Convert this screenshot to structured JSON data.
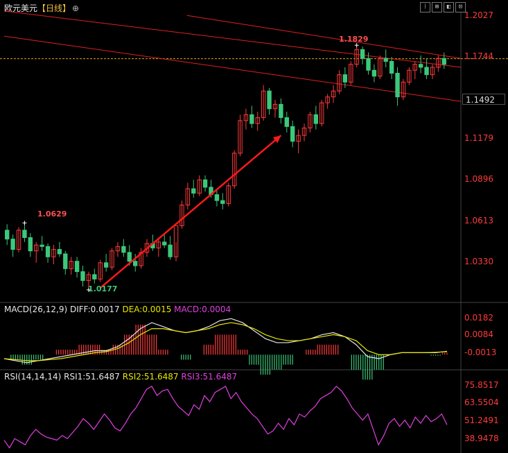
{
  "header": {
    "instrument": "欧元美元",
    "period": "【日线】",
    "settings_glyph": "⊕",
    "toolbar": [
      "⁞",
      "⊞",
      "◧",
      "⊡"
    ]
  },
  "main_price_axis": {
    "ticks": [
      "1.2027",
      "1.1744",
      "1.1492",
      "1.1179",
      "1.0896",
      "1.0613",
      "1.0330"
    ],
    "current_price": "1.1492"
  },
  "annotations": {
    "high_label": "1.1829",
    "early_high_label": "1.0629",
    "low_label": "1.0177"
  },
  "macd_panel": {
    "label_name": "MACD(26,12,9)",
    "diff": "DIFF:0.0017",
    "dea": "DEA:0.0015",
    "macd": "MACD:0.0004",
    "ticks": [
      "0.0182",
      "0.0084",
      "-0.0013"
    ]
  },
  "rsi_panel": {
    "label_name": "RSI(14,14,14)",
    "rsi1": "RSI1:51.6487",
    "rsi2": "RSI2:51.6487",
    "rsi3": "RSI3:51.6487",
    "ticks": [
      "75.8517",
      "63.5504",
      "51.2491",
      "38.9478"
    ]
  },
  "colors": {
    "up": "#ff3b3b",
    "down": "#3cc87a",
    "channel": "#e02020",
    "arrow": "#ff1a1a",
    "diff_line": "#e8e8e8",
    "dea_line": "#e8e800",
    "rsi_line": "#e040e0"
  },
  "chart_data": [
    {
      "type": "candlestick",
      "title": "欧元美元【日线】",
      "ylim": [
        1.012,
        1.205
      ],
      "price_ticks": [
        1.2027,
        1.1744,
        1.1492,
        1.1179,
        1.0896,
        1.0613,
        1.033
      ],
      "current_price": 1.1492,
      "reference_line": 1.1738,
      "annotations": [
        {
          "label": "1.1829",
          "value": 1.1829,
          "kind": "high"
        },
        {
          "label": "1.0629",
          "value": 1.0629,
          "kind": "high"
        },
        {
          "label": "1.0177",
          "value": 1.0177,
          "kind": "low"
        }
      ],
      "candles_ohlc": [
        [
          1.058,
          1.062,
          1.048,
          1.052
        ],
        [
          1.052,
          1.055,
          1.04,
          1.045
        ],
        [
          1.045,
          1.06,
          1.043,
          1.058
        ],
        [
          1.058,
          1.063,
          1.05,
          1.053
        ],
        [
          1.053,
          1.056,
          1.04,
          1.044
        ],
        [
          1.044,
          1.05,
          1.036,
          1.048
        ],
        [
          1.048,
          1.054,
          1.044,
          1.047
        ],
        [
          1.047,
          1.049,
          1.036,
          1.04
        ],
        [
          1.04,
          1.048,
          1.035,
          1.045
        ],
        [
          1.045,
          1.05,
          1.04,
          1.042
        ],
        [
          1.042,
          1.044,
          1.028,
          1.032
        ],
        [
          1.032,
          1.04,
          1.028,
          1.037
        ],
        [
          1.037,
          1.04,
          1.026,
          1.03
        ],
        [
          1.03,
          1.034,
          1.02,
          1.024
        ],
        [
          1.024,
          1.03,
          1.018,
          1.028
        ],
        [
          1.028,
          1.032,
          1.022,
          1.025
        ],
        [
          1.025,
          1.038,
          1.023,
          1.036
        ],
        [
          1.036,
          1.042,
          1.03,
          1.033
        ],
        [
          1.033,
          1.046,
          1.031,
          1.044
        ],
        [
          1.044,
          1.05,
          1.04,
          1.047
        ],
        [
          1.047,
          1.052,
          1.04,
          1.043
        ],
        [
          1.043,
          1.048,
          1.034,
          1.037
        ],
        [
          1.037,
          1.042,
          1.03,
          1.034
        ],
        [
          1.034,
          1.046,
          1.032,
          1.043
        ],
        [
          1.043,
          1.052,
          1.04,
          1.049
        ],
        [
          1.049,
          1.055,
          1.044,
          1.046
        ],
        [
          1.046,
          1.052,
          1.04,
          1.05
        ],
        [
          1.05,
          1.056,
          1.046,
          1.048
        ],
        [
          1.048,
          1.054,
          1.038,
          1.04
        ],
        [
          1.04,
          1.05,
          1.037,
          1.061
        ],
        [
          1.061,
          1.078,
          1.059,
          1.075
        ],
        [
          1.075,
          1.09,
          1.072,
          1.086
        ],
        [
          1.086,
          1.092,
          1.08,
          1.083
        ],
        [
          1.083,
          1.095,
          1.081,
          1.092
        ],
        [
          1.092,
          1.095,
          1.084,
          1.087
        ],
        [
          1.087,
          1.092,
          1.08,
          1.082
        ],
        [
          1.082,
          1.086,
          1.074,
          1.078
        ],
        [
          1.078,
          1.083,
          1.072,
          1.076
        ],
        [
          1.076,
          1.09,
          1.074,
          1.088
        ],
        [
          1.088,
          1.112,
          1.086,
          1.11
        ],
        [
          1.11,
          1.136,
          1.108,
          1.132
        ],
        [
          1.132,
          1.14,
          1.126,
          1.136
        ],
        [
          1.136,
          1.142,
          1.127,
          1.13
        ],
        [
          1.13,
          1.138,
          1.125,
          1.134
        ],
        [
          1.134,
          1.156,
          1.132,
          1.152
        ],
        [
          1.152,
          1.154,
          1.136,
          1.14
        ],
        [
          1.14,
          1.146,
          1.134,
          1.143
        ],
        [
          1.143,
          1.147,
          1.13,
          1.134
        ],
        [
          1.134,
          1.138,
          1.124,
          1.128
        ],
        [
          1.128,
          1.132,
          1.114,
          1.118
        ],
        [
          1.118,
          1.126,
          1.11,
          1.122
        ],
        [
          1.122,
          1.13,
          1.118,
          1.127
        ],
        [
          1.127,
          1.138,
          1.124,
          1.136
        ],
        [
          1.136,
          1.142,
          1.126,
          1.13
        ],
        [
          1.13,
          1.146,
          1.128,
          1.144
        ],
        [
          1.144,
          1.15,
          1.14,
          1.148
        ],
        [
          1.148,
          1.156,
          1.144,
          1.152
        ],
        [
          1.152,
          1.166,
          1.15,
          1.163
        ],
        [
          1.163,
          1.168,
          1.154,
          1.158
        ],
        [
          1.158,
          1.172,
          1.156,
          1.17
        ],
        [
          1.17,
          1.183,
          1.168,
          1.18
        ],
        [
          1.18,
          1.182,
          1.17,
          1.174
        ],
        [
          1.174,
          1.178,
          1.163,
          1.166
        ],
        [
          1.166,
          1.17,
          1.158,
          1.162
        ],
        [
          1.162,
          1.176,
          1.16,
          1.174
        ],
        [
          1.174,
          1.18,
          1.168,
          1.172
        ],
        [
          1.172,
          1.175,
          1.16,
          1.164
        ],
        [
          1.164,
          1.168,
          1.142,
          1.148
        ],
        [
          1.148,
          1.16,
          1.146,
          1.158
        ],
        [
          1.158,
          1.168,
          1.156,
          1.166
        ],
        [
          1.166,
          1.172,
          1.16,
          1.17
        ],
        [
          1.17,
          1.176,
          1.164,
          1.168
        ],
        [
          1.168,
          1.174,
          1.16,
          1.163
        ],
        [
          1.163,
          1.17,
          1.16,
          1.168
        ],
        [
          1.168,
          1.176,
          1.165,
          1.174
        ],
        [
          1.174,
          1.178,
          1.167,
          1.17
        ]
      ],
      "channel_lines": [
        [
          [
            0,
            1.189
          ],
          [
            1,
            1.145
          ]
        ],
        [
          [
            0,
            1.206
          ],
          [
            1,
            1.168
          ]
        ],
        [
          [
            0.4,
            1.203
          ],
          [
            1,
            1.174
          ]
        ]
      ]
    },
    {
      "type": "line",
      "title": "MACD(26,12,9)",
      "ylim": [
        -0.0065,
        0.0195
      ],
      "ticks": [
        0.0182,
        0.0084,
        -0.0013
      ],
      "legend": [
        "DIFF:0.0017",
        "DEA:0.0015",
        "MACD:0.0004"
      ],
      "series": [
        {
          "name": "DIFF",
          "values": [
            -0.002,
            -0.003,
            -0.004,
            -0.003,
            -0.002,
            -0.001,
            0.0,
            0.001,
            0.002,
            0.002,
            0.004,
            0.008,
            0.013,
            0.016,
            0.014,
            0.012,
            0.011,
            0.012,
            0.014,
            0.017,
            0.018,
            0.016,
            0.012,
            0.008,
            0.006,
            0.006,
            0.007,
            0.008,
            0.01,
            0.011,
            0.009,
            0.005,
            -0.001,
            -0.002,
            0.0,
            0.001,
            0.001,
            0.001,
            0.001,
            0.0017
          ]
        },
        {
          "name": "DEA",
          "values": [
            -0.002,
            -0.0025,
            -0.003,
            -0.003,
            -0.0025,
            -0.002,
            -0.001,
            0.0,
            0.001,
            0.0015,
            0.003,
            0.006,
            0.01,
            0.013,
            0.013,
            0.012,
            0.011,
            0.012,
            0.013,
            0.015,
            0.016,
            0.015,
            0.013,
            0.01,
            0.008,
            0.007,
            0.007,
            0.008,
            0.009,
            0.01,
            0.009,
            0.007,
            0.002,
            0.0,
            0.0,
            0.001,
            0.001,
            0.001,
            0.0012,
            0.0015
          ]
        },
        {
          "name": "MACD",
          "values": [
            0.0,
            -0.001,
            -0.002,
            -0.001,
            0.0,
            0.001,
            0.001,
            0.002,
            0.002,
            0.001,
            0.002,
            0.004,
            0.006,
            0.004,
            0.001,
            0.0,
            -0.001,
            0.0,
            0.002,
            0.004,
            0.004,
            0.001,
            -0.002,
            -0.004,
            -0.003,
            -0.002,
            0.0,
            0.001,
            0.002,
            0.002,
            0.0,
            -0.003,
            -0.005,
            -0.003,
            0.0,
            0.0,
            0.0,
            0.0,
            -0.0002,
            0.0004
          ]
        }
      ]
    },
    {
      "type": "line",
      "title": "RSI(14,14,14)",
      "ylim": [
        34,
        80
      ],
      "ticks": [
        75.8517,
        63.5504,
        51.2491,
        38.9478
      ],
      "legend": [
        "RSI1:51.6487",
        "RSI2:51.6487",
        "RSI3:51.6487"
      ],
      "series": [
        {
          "name": "RSI1",
          "values": [
            41,
            36,
            42,
            40,
            38,
            44,
            48,
            45,
            43,
            42,
            41,
            44,
            42,
            46,
            50,
            55,
            52,
            48,
            53,
            58,
            54,
            49,
            47,
            52,
            58,
            62,
            68,
            74,
            76,
            70,
            73,
            74,
            68,
            63,
            60,
            57,
            64,
            61,
            70,
            66,
            72,
            74,
            76,
            68,
            72,
            66,
            62,
            58,
            55,
            50,
            45,
            47,
            52,
            48,
            55,
            51,
            58,
            56,
            60,
            63,
            68,
            70,
            72,
            76,
            73,
            68,
            62,
            58,
            54,
            58,
            48,
            38,
            44,
            52,
            55,
            50,
            54,
            49,
            56,
            52,
            57,
            53,
            55,
            58,
            51
          ]
        },
        {
          "name": "RSI2",
          "values": [
            41,
            36,
            42,
            40,
            38,
            44,
            48,
            45,
            43,
            42,
            41,
            44,
            42,
            46,
            50,
            55,
            52,
            48,
            53,
            58,
            54,
            49,
            47,
            52,
            58,
            62,
            68,
            74,
            76,
            70,
            73,
            74,
            68,
            63,
            60,
            57,
            64,
            61,
            70,
            66,
            72,
            74,
            76,
            68,
            72,
            66,
            62,
            58,
            55,
            50,
            45,
            47,
            52,
            48,
            55,
            51,
            58,
            56,
            60,
            63,
            68,
            70,
            72,
            76,
            73,
            68,
            62,
            58,
            54,
            58,
            48,
            38,
            44,
            52,
            55,
            50,
            54,
            49,
            56,
            52,
            57,
            53,
            55,
            58,
            51
          ]
        },
        {
          "name": "RSI3",
          "values": [
            41,
            36,
            42,
            40,
            38,
            44,
            48,
            45,
            43,
            42,
            41,
            44,
            42,
            46,
            50,
            55,
            52,
            48,
            53,
            58,
            54,
            49,
            47,
            52,
            58,
            62,
            68,
            74,
            76,
            70,
            73,
            74,
            68,
            63,
            60,
            57,
            64,
            61,
            70,
            66,
            72,
            74,
            76,
            68,
            72,
            66,
            62,
            58,
            55,
            50,
            45,
            47,
            52,
            48,
            55,
            51,
            58,
            56,
            60,
            63,
            68,
            70,
            72,
            76,
            73,
            68,
            62,
            58,
            54,
            58,
            48,
            38,
            44,
            52,
            55,
            50,
            54,
            49,
            56,
            52,
            57,
            53,
            55,
            58,
            51
          ]
        }
      ]
    }
  ]
}
